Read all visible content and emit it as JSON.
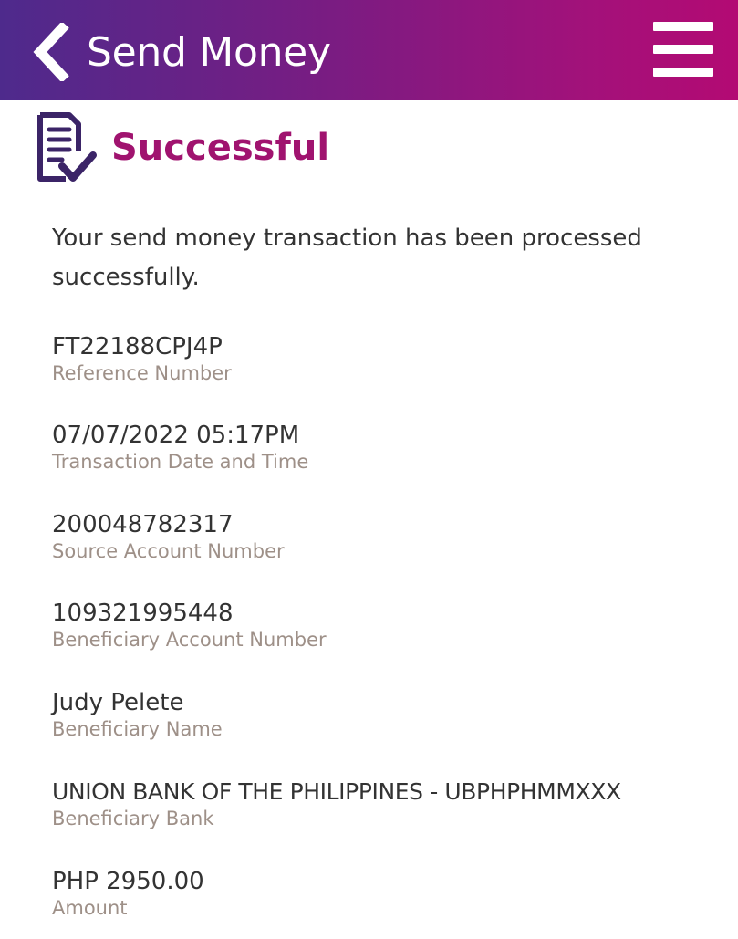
{
  "header": {
    "title": "Send Money",
    "back_icon": "chevron-left-icon",
    "menu_icon": "hamburger-menu-icon"
  },
  "status": {
    "icon": "document-check-icon",
    "title": "Successful",
    "message": "Your send money transaction has been processed successfully."
  },
  "details": [
    {
      "value": "FT22188CPJ4P",
      "label": "Reference Number"
    },
    {
      "value": "07/07/2022 05:17PM",
      "label": "Transaction Date and Time"
    },
    {
      "value": "200048782317",
      "label": "Source Account Number"
    },
    {
      "value": "109321995448",
      "label": "Beneficiary Account Number"
    },
    {
      "value": "Judy Pelete",
      "label": "Beneficiary Name"
    },
    {
      "value": "UNION BANK OF THE PHILIPPINES - UBPHPHMMXXX",
      "label": "Beneficiary Bank"
    },
    {
      "value": "PHP 2950.00",
      "label": "Amount"
    }
  ],
  "colors": {
    "header_start": "#4e2a8c",
    "header_end": "#b30a73",
    "success_title": "#a0136f",
    "icon": "#3b2467",
    "label": "#9e9088",
    "text": "#333333"
  }
}
